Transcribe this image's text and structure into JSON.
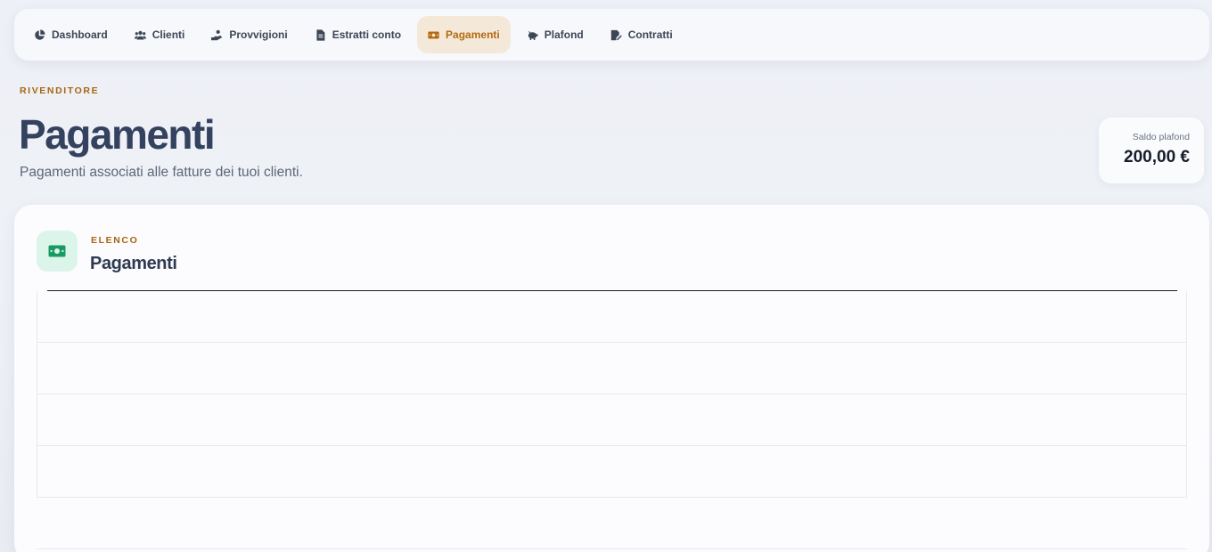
{
  "nav": {
    "items": [
      {
        "label": "Dashboard",
        "icon": "pie-chart-icon"
      },
      {
        "label": "Clienti",
        "icon": "users-icon"
      },
      {
        "label": "Provvigioni",
        "icon": "hand-coin-icon"
      },
      {
        "label": "Estratti conto",
        "icon": "document-icon"
      },
      {
        "label": "Pagamenti",
        "icon": "banknote-icon",
        "active": true
      },
      {
        "label": "Plafond",
        "icon": "piggy-bank-icon"
      },
      {
        "label": "Contratti",
        "icon": "signature-icon"
      }
    ]
  },
  "header": {
    "eyebrow": "RIVENDITORE",
    "title": "Pagamenti",
    "subtitle": "Pagamenti associati alle fatture dei tuoi clienti."
  },
  "balance": {
    "label": "Saldo plafond",
    "value": "200,00 €"
  },
  "section": {
    "eyebrow": "ELENCO",
    "title": "Pagamenti",
    "icon": "banknote-icon"
  },
  "colors": {
    "accent": "#b46a12",
    "active_bg": "#f4e9d8",
    "title": "#34425f",
    "icon_green": "#1a9a63",
    "icon_green_bg": "#dcf5ea"
  }
}
